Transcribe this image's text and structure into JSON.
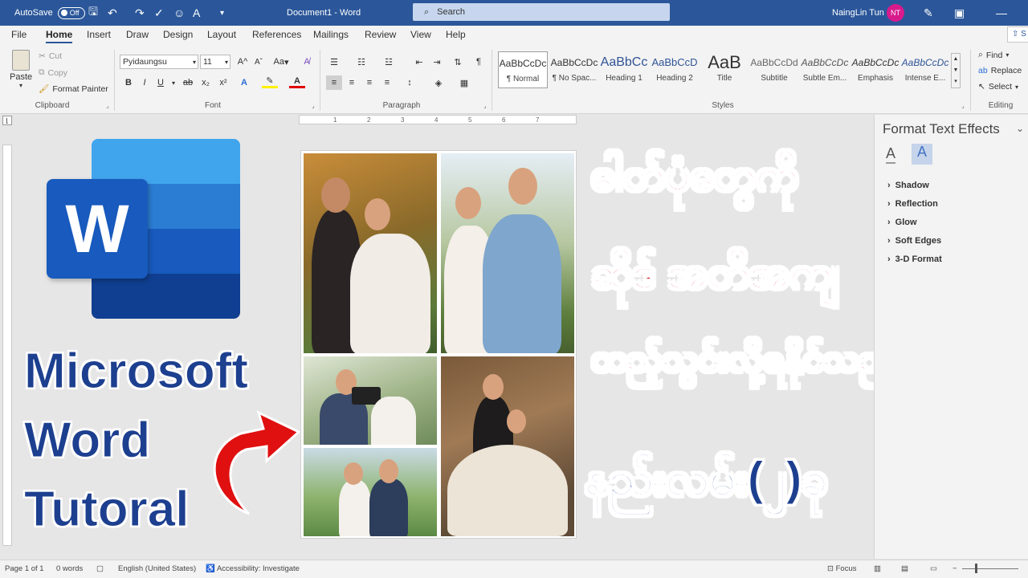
{
  "titlebar": {
    "autosave_label": "AutoSave",
    "autosave_state": "Off",
    "document_title": "Document1  -  Word",
    "search_placeholder": "Search",
    "user_name": "NaingLin Tun",
    "user_initials": "NT"
  },
  "menu": {
    "tabs": [
      "File",
      "Home",
      "Insert",
      "Draw",
      "Design",
      "Layout",
      "References",
      "Mailings",
      "Review",
      "View",
      "Help"
    ],
    "share_label": "S"
  },
  "ribbon": {
    "clipboard": {
      "paste": "Paste",
      "cut": "Cut",
      "copy": "Copy",
      "format_painter": "Format Painter",
      "label": "Clipboard"
    },
    "font": {
      "name": "Pyidaungsu",
      "size": "11",
      "grow": "A",
      "shrink": "A",
      "case": "Aa",
      "bold": "B",
      "italic": "I",
      "underline": "U",
      "strike": "ab",
      "subscript": "x₂",
      "superscript": "x²",
      "label": "Font"
    },
    "paragraph": {
      "label": "Paragraph"
    },
    "styles": {
      "items": [
        {
          "sample": "AaBbCcDc",
          "name": "¶ Normal"
        },
        {
          "sample": "AaBbCcDc",
          "name": "¶ No Spac..."
        },
        {
          "sample": "AaBbCc",
          "name": "Heading 1"
        },
        {
          "sample": "AaBbCcD",
          "name": "Heading 2"
        },
        {
          "sample": "AaB",
          "name": "Title"
        },
        {
          "sample": "AaBbCcDd",
          "name": "Subtitle"
        },
        {
          "sample": "AaBbCcDc",
          "name": "Subtle Em..."
        },
        {
          "sample": "AaBbCcDc",
          "name": "Emphasis"
        },
        {
          "sample": "AaBbCcDc",
          "name": "Intense E..."
        }
      ],
      "label": "Styles"
    },
    "editing": {
      "find": "Find",
      "replace": "Replace",
      "select": "Select",
      "label": "Editing"
    }
  },
  "ruler": {
    "marks": [
      "1",
      "2",
      "3",
      "4",
      "5",
      "6",
      "7"
    ]
  },
  "canvas": {
    "logo_letter": "W",
    "left_text": [
      "Microsoft",
      "Word",
      "Tutoral"
    ],
    "burmese_lines": [
      "ဓါတ်ပုံတွေကို",
      "ဆိုဒ် အတိအကျ",
      "ထည့်သွင်းလို့ရနိုင်သည့်",
      "နည်းလမ်း(၂)ခု"
    ],
    "colors": {
      "red_text": "#d0101d",
      "blue_text": "#1d3f8f",
      "arrow": "#e01010"
    }
  },
  "panel": {
    "title": "Format Text Effects",
    "items": [
      "Shadow",
      "Reflection",
      "Glow",
      "Soft Edges",
      "3-D Format"
    ]
  },
  "status": {
    "page": "Page 1 of 1",
    "words": "0 words",
    "language": "English (United States)",
    "accessibility": "Accessibility: Investigate",
    "focus": "Focus"
  }
}
